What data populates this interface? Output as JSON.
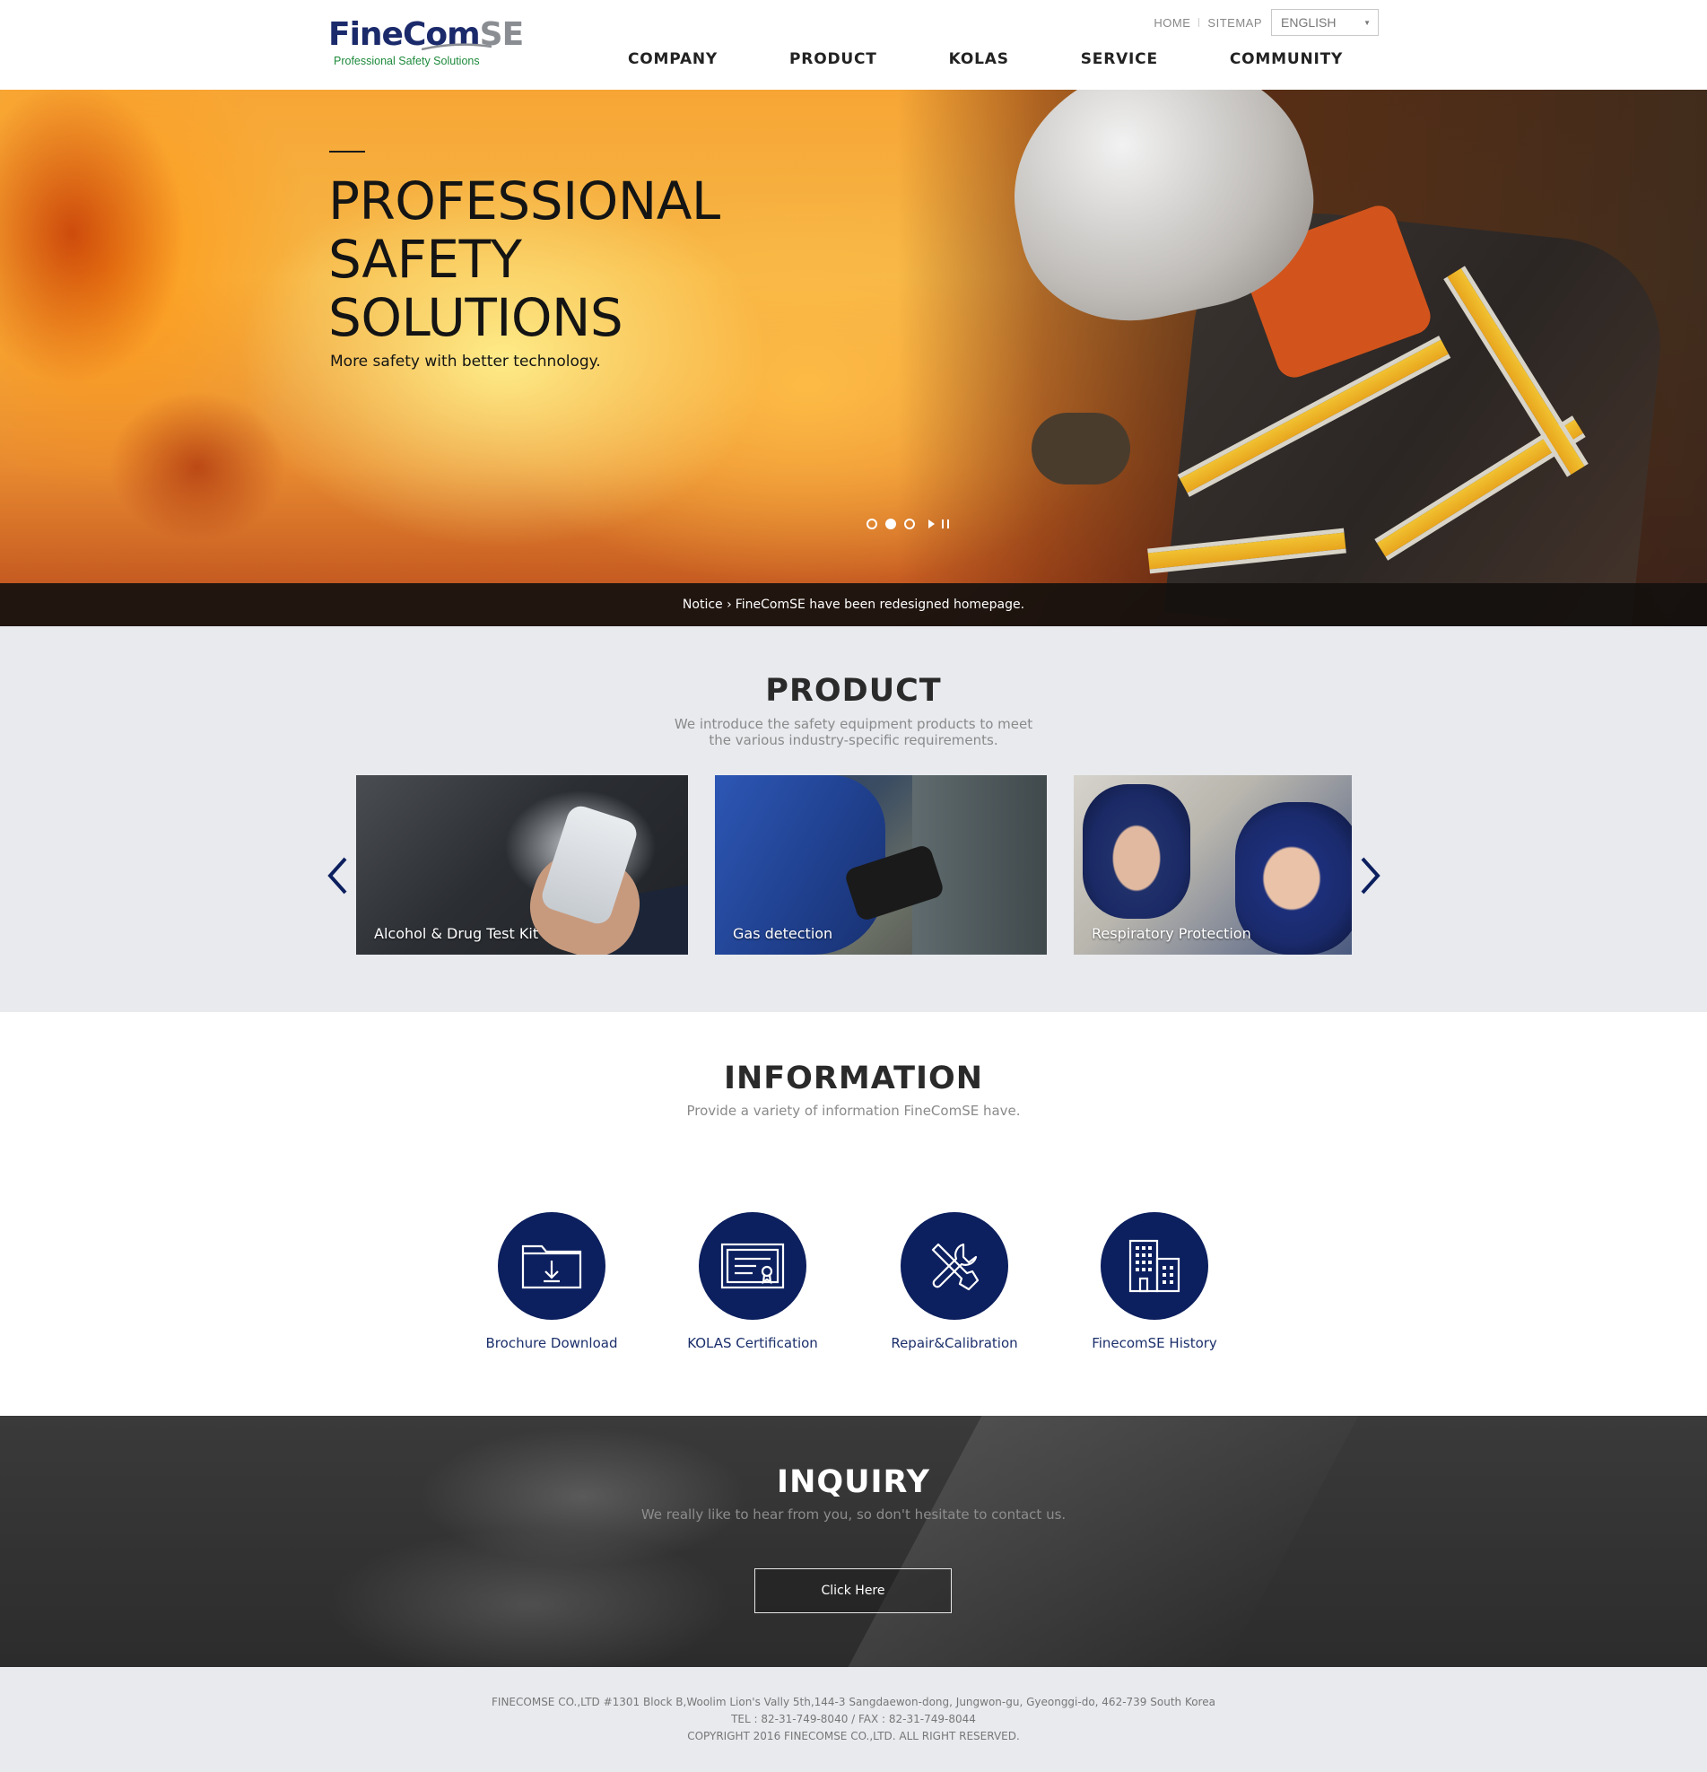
{
  "header": {
    "logo": {
      "name_part1": "FineCom",
      "name_part2": "SE",
      "tagline": "Professional Safety Solutions"
    },
    "util": {
      "home": "HOME",
      "sitemap": "SITEMAP",
      "language": "ENGLISH"
    },
    "nav": [
      "COMPANY",
      "PRODUCT",
      "KOLAS",
      "SERVICE",
      "COMMUNITY"
    ]
  },
  "hero": {
    "title_lines": [
      "PROFESSIONAL",
      "SAFETY",
      "SOLUTIONS"
    ],
    "tagline": "More safety with better technology.",
    "slides": {
      "count": 3,
      "active_index": 1
    },
    "notice": {
      "label": "Notice ›",
      "text": "FineComSE have been redesigned homepage."
    }
  },
  "product": {
    "title": "PRODUCT",
    "desc_line1": "We introduce the safety equipment products to meet",
    "desc_line2": "the various industry-specific requirements.",
    "items": [
      {
        "label": "Alcohol & Drug Test Kit"
      },
      {
        "label": "Gas detection"
      },
      {
        "label": "Respiratory Protection"
      }
    ]
  },
  "information": {
    "title": "INFORMATION",
    "desc": "Provide a variety of information FineComSE have.",
    "items": [
      {
        "label": "Brochure Download",
        "icon": "folder-download-icon"
      },
      {
        "label": "KOLAS Certification",
        "icon": "certificate-icon"
      },
      {
        "label": "Repair&Calibration",
        "icon": "wrench-screwdriver-icon"
      },
      {
        "label": "FinecomSE History",
        "icon": "building-icon"
      }
    ]
  },
  "inquiry": {
    "title": "INQUIRY",
    "desc": "We really like to hear from you, so don't hesitate to contact us.",
    "button": "Click Here"
  },
  "footer": {
    "address": "FINECOMSE CO.,LTD #1301 Block B,Woolim Lion's Vally 5th,144-3 Sangdaewon-dong, Jungwon-gu, Gyeonggi-do, 462-739 South Korea",
    "contact": "TEL : 82-31-749-8040 / FAX : 82-31-749-8044",
    "copyright": "COPYRIGHT 2016 FINECOMSE CO.,LTD. ALL RIGHT RESERVED."
  },
  "colors": {
    "navy": "#0c1f5e",
    "logo_green": "#1e8a3c",
    "section_gray": "#e8eaee",
    "inquiry_dark": "#2c2c2c"
  }
}
